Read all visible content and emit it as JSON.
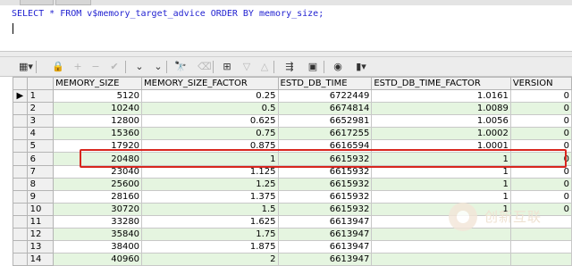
{
  "editor": {
    "sql": {
      "kw1": "SELECT",
      "star": " * ",
      "kw2": "FROM",
      "view": " v$memory_target_advice ",
      "kw3": "ORDER BY",
      "col": " memory_size;"
    }
  },
  "toolbar": {
    "buttons": [
      {
        "name": "grid-options-icon",
        "glyph": "▦▾"
      },
      {
        "name": "lock-icon",
        "glyph": "🔒"
      },
      {
        "name": "add-record-icon",
        "glyph": "+"
      },
      {
        "name": "delete-record-icon",
        "glyph": "−"
      },
      {
        "name": "post-changes-icon",
        "glyph": "✔"
      },
      {
        "name": "fetch-next-icon",
        "glyph": "⌄"
      },
      {
        "name": "fetch-last-icon",
        "glyph": "⌄"
      },
      {
        "name": "find-icon",
        "glyph": "🔭"
      },
      {
        "name": "clear-icon",
        "glyph": "⌫"
      },
      {
        "name": "query-by-example-icon",
        "glyph": "⊞"
      },
      {
        "name": "previous-icon",
        "glyph": "▽"
      },
      {
        "name": "next-icon",
        "glyph": "△"
      },
      {
        "name": "export-icon",
        "glyph": "⇶"
      },
      {
        "name": "save-icon",
        "glyph": "▣"
      },
      {
        "name": "connection-icon",
        "glyph": "◉"
      },
      {
        "name": "chart-icon",
        "glyph": "▮▾"
      }
    ]
  },
  "grid": {
    "columns": [
      "MEMORY_SIZE",
      "MEMORY_SIZE_FACTOR",
      "ESTD_DB_TIME",
      "ESTD_DB_TIME_FACTOR",
      "VERSION"
    ],
    "current_row_marker": "▶",
    "rows": [
      {
        "n": "1",
        "c": [
          "5120",
          "0.25",
          "6722449",
          "1.0161",
          "0"
        ]
      },
      {
        "n": "2",
        "c": [
          "10240",
          "0.5",
          "6674814",
          "1.0089",
          "0"
        ]
      },
      {
        "n": "3",
        "c": [
          "12800",
          "0.625",
          "6652981",
          "1.0056",
          "0"
        ]
      },
      {
        "n": "4",
        "c": [
          "15360",
          "0.75",
          "6617255",
          "1.0002",
          "0"
        ]
      },
      {
        "n": "5",
        "c": [
          "17920",
          "0.875",
          "6616594",
          "1.0001",
          "0"
        ]
      },
      {
        "n": "6",
        "c": [
          "20480",
          "1",
          "6615932",
          "1",
          "0"
        ]
      },
      {
        "n": "7",
        "c": [
          "23040",
          "1.125",
          "6615932",
          "1",
          "0"
        ]
      },
      {
        "n": "8",
        "c": [
          "25600",
          "1.25",
          "6615932",
          "1",
          "0"
        ]
      },
      {
        "n": "9",
        "c": [
          "28160",
          "1.375",
          "6615932",
          "1",
          "0"
        ]
      },
      {
        "n": "10",
        "c": [
          "30720",
          "1.5",
          "6615932",
          "1",
          "0"
        ]
      },
      {
        "n": "11",
        "c": [
          "33280",
          "1.625",
          "6613947",
          "",
          ""
        ]
      },
      {
        "n": "12",
        "c": [
          "35840",
          "1.75",
          "6613947",
          "",
          ""
        ]
      },
      {
        "n": "13",
        "c": [
          "38400",
          "1.875",
          "6613947",
          "",
          ""
        ]
      },
      {
        "n": "14",
        "c": [
          "40960",
          "2",
          "6613947",
          "",
          ""
        ]
      }
    ]
  },
  "watermark": {
    "text": "创新互联"
  }
}
